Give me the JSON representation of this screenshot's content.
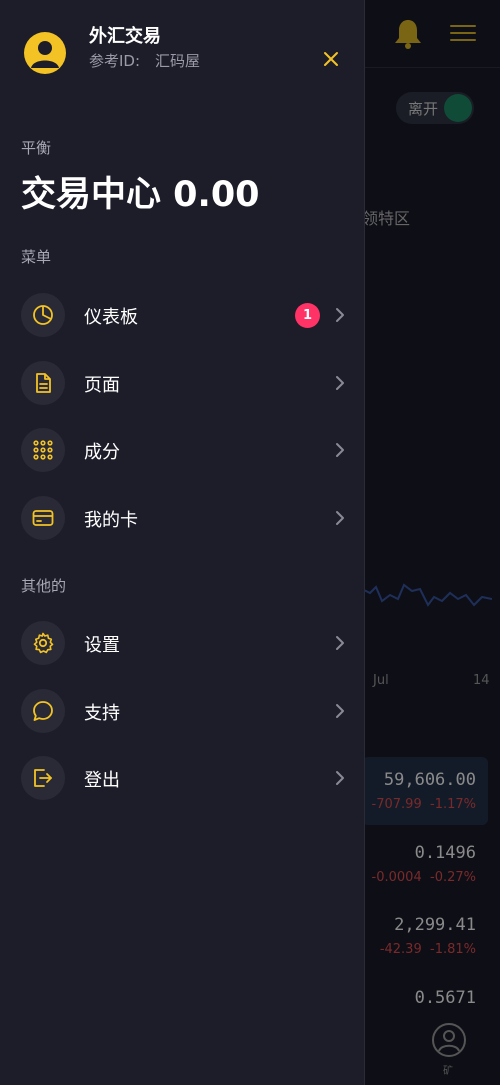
{
  "colors": {
    "accent": "#f3c326",
    "drawer_bg": "#1d1d2a",
    "icon_bg": "#292a35",
    "badge": "#ff3366",
    "muted_text": "#a7a7b3"
  },
  "drawer": {
    "app_name": "外汇交易",
    "ref_label": "参考ID:",
    "ref_value": "汇码屋",
    "close_icon": "close-icon",
    "balance_label": "平衡",
    "balance_value": "交易中心 0.00",
    "menu_section_label": "菜单",
    "menu_items": [
      {
        "label": "仪表板",
        "icon": "pie-chart-icon",
        "badge": "1"
      },
      {
        "label": "页面",
        "icon": "document-icon"
      },
      {
        "label": "成分",
        "icon": "grid-dots-icon"
      },
      {
        "label": "我的卡",
        "icon": "credit-card-icon"
      }
    ],
    "other_section_label": "其他的",
    "other_items": [
      {
        "label": "设置",
        "icon": "gear-icon"
      },
      {
        "label": "支持",
        "icon": "chat-bubble-icon"
      },
      {
        "label": "登出",
        "icon": "logout-icon"
      }
    ]
  },
  "background": {
    "toggle_label": "离开",
    "zone_label": "领特区",
    "axis_labels": [
      "Jul",
      "14"
    ],
    "rows": [
      {
        "price": "59,606.00",
        "change": "-707.99",
        "percent": "-1.17%"
      },
      {
        "price": "0.1496",
        "change": "-0.0004",
        "percent": "-0.27%"
      },
      {
        "price": "2,299.41",
        "change": "-42.39",
        "percent": "-1.81%"
      },
      {
        "price": "0.5671",
        "change": "",
        "percent": ""
      }
    ],
    "user_label": "矿"
  }
}
